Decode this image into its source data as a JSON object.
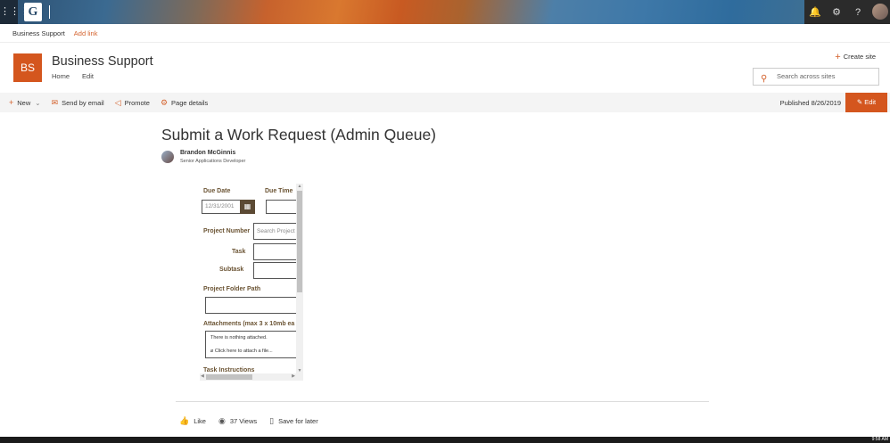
{
  "suitebar": {
    "waffle_icon": "waffle-icon",
    "logo_char": "G",
    "icons": [
      "bell-icon",
      "gear-icon",
      "help-icon"
    ],
    "bell_glyph": "🔔",
    "gear_glyph": "⚙",
    "help_glyph": "?"
  },
  "hubnav": {
    "site_name": "Business Support",
    "add_link": "Add link"
  },
  "site": {
    "initials": "BS",
    "title": "Business Support",
    "nav": [
      "Home",
      "Edit"
    ],
    "create_site": "Create site",
    "search_placeholder": "Search across sites"
  },
  "commandbar": {
    "new": "New",
    "send_email": "Send by email",
    "promote": "Promote",
    "page_details": "Page details",
    "published": "Published 8/26/2019",
    "edit": "Edit"
  },
  "page": {
    "title": "Submit a Work Request (Admin Queue)",
    "author_name": "Brandon McGinnis",
    "author_role": "Senior Applications Developer"
  },
  "form": {
    "due_date_label": "Due Date",
    "due_date_value": "12/31/2001",
    "due_time_label": "Due Time",
    "project_number_label": "Project Number",
    "project_number_placeholder": "Search Project",
    "task_label": "Task",
    "subtask_label": "Subtask",
    "project_folder_label": "Project Folder Path",
    "attachments_label": "Attachments (max 3 x 10mb ea",
    "attachments_empty": "There is nothing attached.",
    "attach_prompt": "Click here to attach a file...",
    "task_instructions_label": "Task Instructions"
  },
  "social": {
    "like": "Like",
    "views": "37 Views",
    "save_later": "Save for later"
  },
  "taskbar": {
    "clock": "9:58 AM"
  },
  "colors": {
    "accent": "#d4561e",
    "form_label": "#6b5434",
    "calendar_button": "#5c4a34"
  }
}
